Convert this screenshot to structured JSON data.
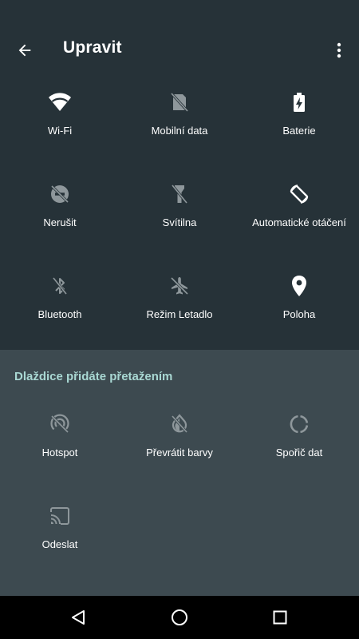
{
  "header": {
    "title": "Upravit"
  },
  "active_tiles": [
    {
      "label": "Wi-Fi",
      "icon": "wifi-icon"
    },
    {
      "label": "Mobilní data",
      "icon": "mobile-data-off-icon"
    },
    {
      "label": "Baterie",
      "icon": "battery-charging-icon"
    },
    {
      "label": "Nerušit",
      "icon": "do-not-disturb-off-icon"
    },
    {
      "label": "Svítilna",
      "icon": "flashlight-off-icon"
    },
    {
      "label": "Automatické otáčení",
      "icon": "screen-rotation-icon"
    },
    {
      "label": "Bluetooth",
      "icon": "bluetooth-off-icon"
    },
    {
      "label": "Režim Letadlo",
      "icon": "airplane-off-icon"
    },
    {
      "label": "Poloha",
      "icon": "location-icon"
    }
  ],
  "available_section": {
    "heading": "Dlaždice přidáte přetažením",
    "tiles": [
      {
        "label": "Hotspot",
        "icon": "hotspot-off-icon"
      },
      {
        "label": "Převrátit barvy",
        "icon": "invert-colors-off-icon"
      },
      {
        "label": "Spořič dat",
        "icon": "data-saver-icon"
      },
      {
        "label": "Odeslat",
        "icon": "cast-icon"
      }
    ]
  },
  "colors": {
    "background_top": "#263238",
    "background_bottom": "#3d4a50",
    "heading_accent": "#a9d8d3",
    "icon_dim": "#8e979b",
    "icon_active": "#ffffff",
    "navbar": "#000000"
  }
}
